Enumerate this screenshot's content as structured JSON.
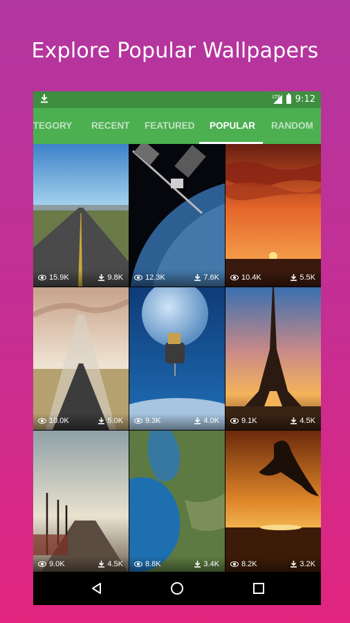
{
  "headline": "Explore Popular Wallpapers",
  "status_bar": {
    "time": "9:12",
    "network": "LTE"
  },
  "tabs": [
    {
      "label": "ATEGORY"
    },
    {
      "label": "RECENT"
    },
    {
      "label": "FEATURED"
    },
    {
      "label": "POPULAR",
      "active": true
    },
    {
      "label": "RANDOM"
    }
  ],
  "wallpapers": [
    {
      "subject": "road",
      "views": "15.9K",
      "downloads": "9.8K"
    },
    {
      "subject": "space-station",
      "views": "12.3K",
      "downloads": "7.6K"
    },
    {
      "subject": "sunset-clouds",
      "views": "10.4K",
      "downloads": "5.5K"
    },
    {
      "subject": "desert-road",
      "views": "10.0K",
      "downloads": "5.0K"
    },
    {
      "subject": "moon-satellite",
      "views": "9.3K",
      "downloads": "4.0K"
    },
    {
      "subject": "eiffel-tower",
      "views": "9.1K",
      "downloads": "4.5K"
    },
    {
      "subject": "pier-lamps",
      "views": "9.0K",
      "downloads": "4.5K"
    },
    {
      "subject": "earth-coast",
      "views": "8.8K",
      "downloads": "3.4K"
    },
    {
      "subject": "dolphin-sunset",
      "views": "8.2K",
      "downloads": "3.2K"
    }
  ],
  "colors": {
    "status_bar": "#3e8e3f",
    "tab_bar": "#4caf50",
    "background_top": "#b2369f",
    "background_bottom": "#e1257f"
  }
}
